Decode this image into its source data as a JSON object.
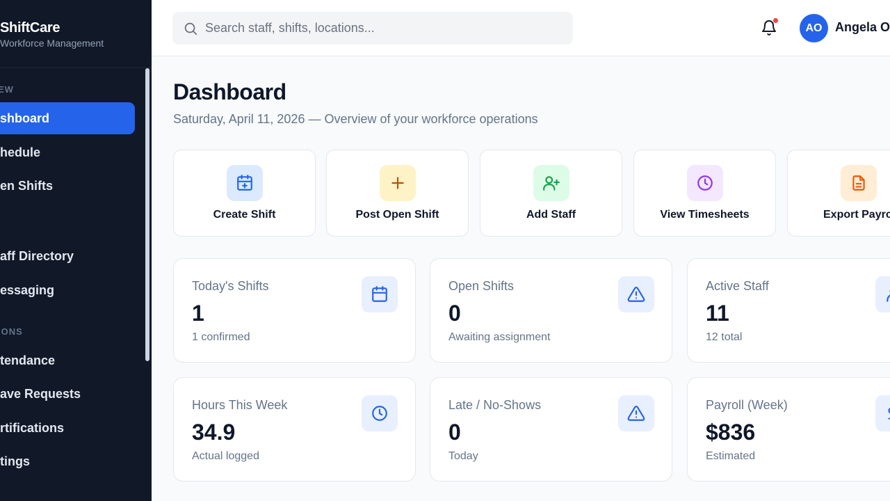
{
  "app": {
    "name": "ShiftCare",
    "tagline": "Workforce Management"
  },
  "sidebar": {
    "sections": [
      "EW",
      "IONS"
    ],
    "items": [
      {
        "label": "shboard",
        "active": true
      },
      {
        "label": "hedule"
      },
      {
        "label": "en Shifts"
      },
      {
        "label": "aff Directory"
      },
      {
        "label": "essaging"
      },
      {
        "label": "tendance"
      },
      {
        "label": "ave Requests"
      },
      {
        "label": "rtifications"
      },
      {
        "label": "tings"
      }
    ]
  },
  "header": {
    "search_placeholder": "Search staff, shifts, locations...",
    "user": {
      "initials": "AO",
      "name": "Angela O"
    },
    "notification_dot": true
  },
  "page": {
    "title": "Dashboard",
    "subtitle": "Saturday, April 11, 2026 — Overview of your workforce operations"
  },
  "quick_actions": [
    {
      "label": "Create Shift",
      "icon": "calendar-plus-icon",
      "color": "#2563eb",
      "bg": "#dbeafe"
    },
    {
      "label": "Post Open Shift",
      "icon": "plus-icon",
      "color": "#b45309",
      "bg": "#fef3c7"
    },
    {
      "label": "Add Staff",
      "icon": "user-plus-icon",
      "color": "#16a34a",
      "bg": "#dcfce7"
    },
    {
      "label": "View Timesheets",
      "icon": "clock-icon",
      "color": "#9333ea",
      "bg": "#f3e8ff"
    },
    {
      "label": "Export Payroll",
      "icon": "file-text-icon",
      "color": "#ea580c",
      "bg": "#ffedd5"
    }
  ],
  "stats": [
    {
      "label": "Today's Shifts",
      "value": "1",
      "sub": "1 confirmed",
      "icon": "calendar-icon"
    },
    {
      "label": "Open Shifts",
      "value": "0",
      "sub": "Awaiting assignment",
      "icon": "alert-triangle-icon"
    },
    {
      "label": "Active Staff",
      "value": "11",
      "sub": "12 total",
      "icon": "user-icon"
    },
    {
      "label": "Hours This Week",
      "value": "34.9",
      "sub": "Actual logged",
      "icon": "clock-icon"
    },
    {
      "label": "Late / No-Shows",
      "value": "0",
      "sub": "Today",
      "icon": "alert-triangle-icon"
    },
    {
      "label": "Payroll (Week)",
      "value": "$836",
      "sub": "Estimated",
      "icon": "dollar-icon"
    }
  ],
  "colors": {
    "accent": "#2563eb",
    "sidebar_bg": "#111827",
    "alert": "#ef4444"
  }
}
